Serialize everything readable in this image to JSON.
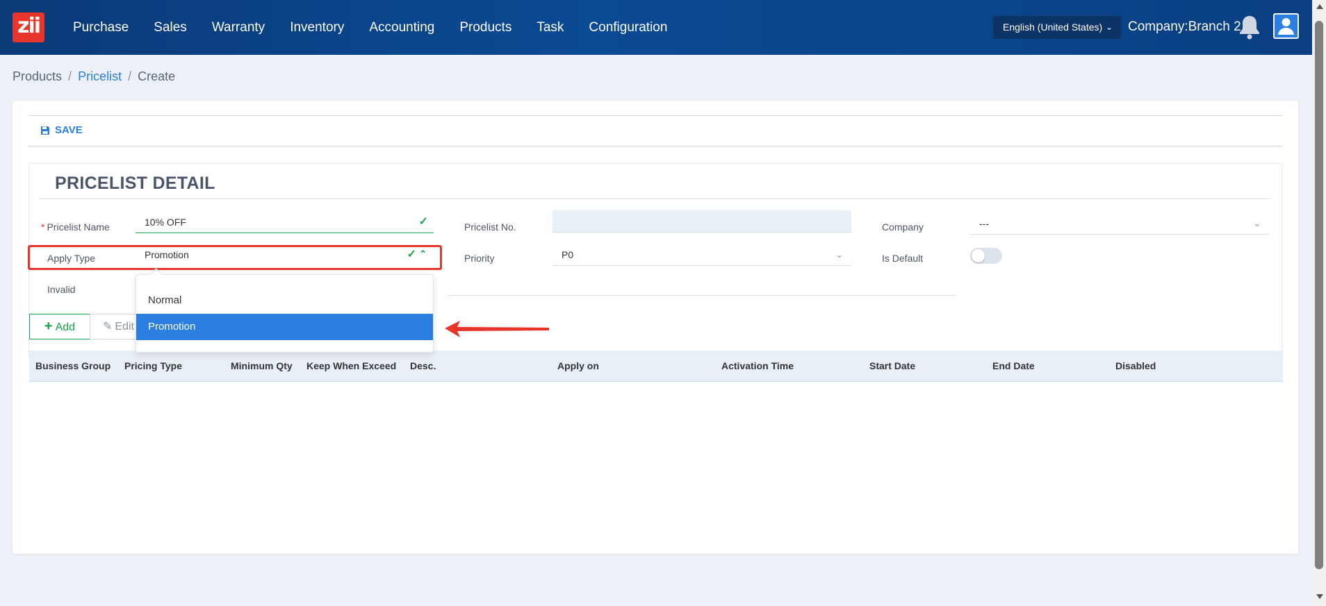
{
  "header": {
    "logo_text": "zii",
    "nav": [
      "Purchase",
      "Sales",
      "Warranty",
      "Inventory",
      "Accounting",
      "Products",
      "Task",
      "Configuration"
    ],
    "language": "English (United States)",
    "company": "Company:Branch 2"
  },
  "breadcrumb": {
    "root": "Products",
    "parent": "Pricelist",
    "current": "Create"
  },
  "toolbar": {
    "save_label": "SAVE"
  },
  "section": {
    "title": "PRICELIST DETAIL"
  },
  "form": {
    "pricelist_name_label": "Pricelist Name",
    "pricelist_name_value": "10% OFF",
    "apply_type_label": "Apply Type",
    "apply_type_value": "Promotion",
    "invalid_label": "Invalid",
    "pricelist_no_label": "Pricelist No.",
    "pricelist_no_value": "",
    "priority_label": "Priority",
    "priority_value": "P0",
    "company_label": "Company",
    "company_value": "---",
    "is_default_label": "Is Default"
  },
  "buttons": {
    "add": "Add",
    "edit": "Edit"
  },
  "table": {
    "headers": [
      "Business Group",
      "Pricing Type",
      "Minimum Qty",
      "Keep When Exceed",
      "Desc.",
      "Apply on",
      "Activation Time",
      "Start Date",
      "End Date",
      "Disabled"
    ]
  },
  "dropdown": {
    "options": [
      "Normal",
      "Promotion"
    ],
    "selected": "Promotion"
  },
  "colors": {
    "header": "#0b4a94",
    "accent": "#2b7fe0",
    "valid": "#1aa34a",
    "highlight": "#e8352b"
  }
}
